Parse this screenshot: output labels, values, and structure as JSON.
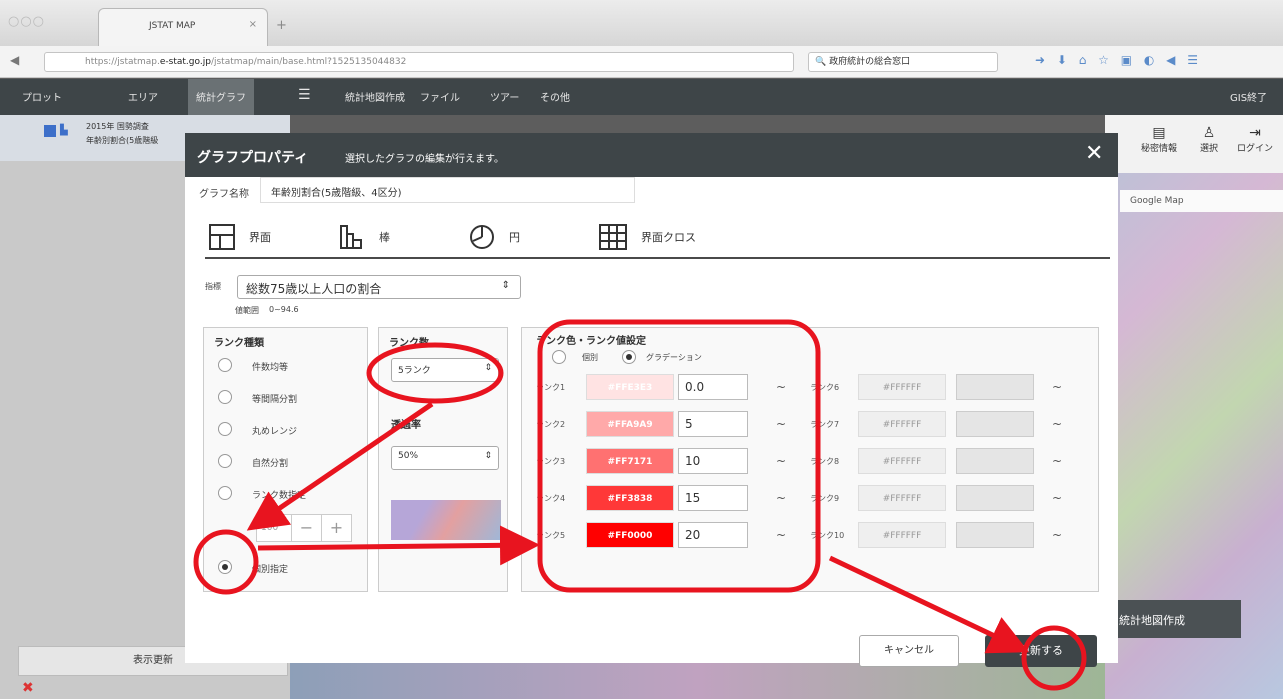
{
  "browser": {
    "tab_title": "JSTAT MAP",
    "url_prefix": "https://jstatmap.",
    "url_domain": "e-stat.go.jp",
    "url_path": "/jstatmap/main/base.html?1525135044832",
    "search_text": "政府統計の総合窓口"
  },
  "appnav": {
    "items": [
      "プロット",
      "エリア",
      "統計グラフ",
      "統計地図作成",
      "ファイル",
      "ツアー",
      "その他"
    ],
    "right": "GIS終了"
  },
  "left": {
    "item_line1": "2015年 国勢調査",
    "item_line2": "年齢別割合(5歳階級",
    "display_update": "表示更新"
  },
  "map": {
    "info": "秘密情報",
    "select": "選択",
    "login": "ログイン",
    "google": "Google Map",
    "create": "統計地図作成"
  },
  "modal": {
    "title": "グラフプロパティ",
    "subtitle": "選択したグラフの編集が行えます。",
    "graph_name_label": "グラフ名称",
    "graph_name": "年齢別割合(5歳階級、4区分)",
    "tabs": [
      "界面",
      "棒",
      "円",
      "界面クロス"
    ],
    "index_label": "指標",
    "index_value": "総数75歳以上人口の割合",
    "range_label": "値範囲",
    "range_value": "0~94.6",
    "rank_type": {
      "title": "ランク種類",
      "options": [
        "件数均等",
        "等間隔分割",
        "丸めレンジ",
        "自然分割",
        "ランク数指定",
        "個別指定"
      ],
      "selected": 5,
      "stepper_value": "100"
    },
    "rank_count": {
      "title": "ランク数",
      "value": "5ランク",
      "opacity_title": "透過率",
      "opacity_value": "50%"
    },
    "rank_color": {
      "title": "ランク色・ランク値設定",
      "mode_individual": "個別",
      "mode_gradation": "グラデーション",
      "ranks": [
        {
          "label": "ランク1",
          "color": "#FFE3E3",
          "value": "0.0"
        },
        {
          "label": "ランク2",
          "color": "#FFA9A9",
          "value": "5"
        },
        {
          "label": "ランク3",
          "color": "#FF7171",
          "value": "10"
        },
        {
          "label": "ランク4",
          "color": "#FF3838",
          "value": "15"
        },
        {
          "label": "ランク5",
          "color": "#FF0000",
          "value": "20"
        }
      ],
      "disabled": [
        {
          "label": "ランク6",
          "color": "#FFFFFF"
        },
        {
          "label": "ランク7",
          "color": "#FFFFFF"
        },
        {
          "label": "ランク8",
          "color": "#FFFFFF"
        },
        {
          "label": "ランク9",
          "color": "#FFFFFF"
        },
        {
          "label": "ランク10",
          "color": "#FFFFFF"
        }
      ],
      "tilde": "~"
    },
    "cancel": "キャンセル",
    "update": "更新する"
  },
  "colors": {
    "annotation": "#e8141f",
    "header": "#3e4548"
  }
}
